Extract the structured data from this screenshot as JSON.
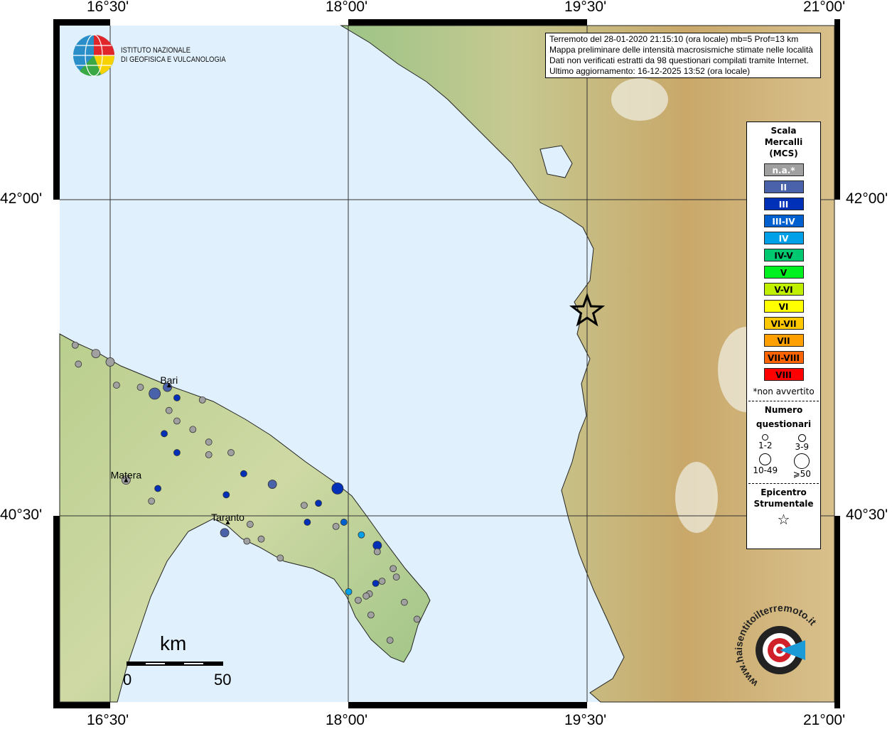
{
  "ticks": {
    "top": [
      "16°30'",
      "18°00'",
      "19°30'",
      "21°00'"
    ],
    "bottom": [
      "16°30'",
      "18°00'",
      "19°30'",
      "21°00'"
    ],
    "left": [
      "42°00'",
      "40°30'"
    ],
    "right": [
      "42°00'",
      "40°30'"
    ]
  },
  "logo_ingv": {
    "line1": "ISTITUTO NAZIONALE",
    "line2": "DI GEOFISICA E VULCANOLOGIA"
  },
  "logo_hsit": "www.haisentitoilterremoto.it",
  "info": {
    "line1": "Terremoto del 28-01-2020 21:15:10 (ora locale) mb=5 Prof=13 km",
    "line2": "Mappa preliminare delle intensità macrosismiche stimate nelle località",
    "line3": "Dati non verificati estratti da 98 questionari compilati tramite Internet.",
    "line4": "Ultimo aggiornamento: 16-12-2025 13:52 (ora locale)"
  },
  "legend": {
    "title1": "Scala",
    "title2": "Mercalli",
    "title3": "(MCS)",
    "classes": [
      {
        "label": "n.a.*",
        "color": "#a0a0a0",
        "text": "#ffffff"
      },
      {
        "label": "II",
        "color": "#4a62aa",
        "text": "#ffffff"
      },
      {
        "label": "III",
        "color": "#0030b8",
        "text": "#ffffff"
      },
      {
        "label": "III-IV",
        "color": "#0060d0",
        "text": "#ffffff"
      },
      {
        "label": "IV",
        "color": "#00a0e8",
        "text": "#ffffff"
      },
      {
        "label": "IV-V",
        "color": "#00c870",
        "text": "#000000"
      },
      {
        "label": "V",
        "color": "#00f020",
        "text": "#000000"
      },
      {
        "label": "V-VI",
        "color": "#c0f000",
        "text": "#000000"
      },
      {
        "label": "VI",
        "color": "#ffff00",
        "text": "#000000"
      },
      {
        "label": "VI-VII",
        "color": "#ffc800",
        "text": "#000000"
      },
      {
        "label": "VII",
        "color": "#ffa000",
        "text": "#000000"
      },
      {
        "label": "VII-VIII",
        "color": "#ff6400",
        "text": "#000000"
      },
      {
        "label": "VIII",
        "color": "#ff0000",
        "text": "#000000"
      }
    ],
    "note": "*non avvertito",
    "count_title1": "Numero",
    "count_title2": "questionari",
    "counts": [
      "1-2",
      "3-9",
      "10-49",
      "⩾50"
    ],
    "epi_title1": "Epicentro",
    "epi_title2": "Strumentale"
  },
  "scalebar": {
    "unit": "km",
    "start": "0",
    "end": "50"
  },
  "cities": [
    {
      "name": "Bari",
      "lon": 16.87,
      "lat": 41.12
    },
    {
      "name": "Matera",
      "lon": 16.6,
      "lat": 40.67
    },
    {
      "name": "Taranto",
      "lon": 17.24,
      "lat": 40.47
    }
  ],
  "epicenter": {
    "lon": 19.5,
    "lat": 41.47
  },
  "points": [
    {
      "lon": 16.28,
      "lat": 41.31,
      "mcs": "n.a.*",
      "n": "1-2"
    },
    {
      "lon": 16.41,
      "lat": 41.27,
      "mcs": "n.a.*",
      "n": "3-9"
    },
    {
      "lon": 16.5,
      "lat": 41.23,
      "mcs": "n.a.*",
      "n": "3-9"
    },
    {
      "lon": 16.3,
      "lat": 41.22,
      "mcs": "n.a.*",
      "n": "1-2"
    },
    {
      "lon": 16.54,
      "lat": 41.12,
      "mcs": "n.a.*",
      "n": "1-2"
    },
    {
      "lon": 16.69,
      "lat": 41.11,
      "mcs": "n.a.*",
      "n": "1-2"
    },
    {
      "lon": 16.78,
      "lat": 41.08,
      "mcs": "II",
      "n": "10-49"
    },
    {
      "lon": 16.86,
      "lat": 41.11,
      "mcs": "II",
      "n": "3-9"
    },
    {
      "lon": 16.92,
      "lat": 41.06,
      "mcs": "III",
      "n": "1-2"
    },
    {
      "lon": 17.08,
      "lat": 41.05,
      "mcs": "n.a.*",
      "n": "1-2"
    },
    {
      "lon": 16.87,
      "lat": 41.0,
      "mcs": "n.a.*",
      "n": "1-2"
    },
    {
      "lon": 16.92,
      "lat": 40.95,
      "mcs": "n.a.*",
      "n": "1-2"
    },
    {
      "lon": 17.02,
      "lat": 40.91,
      "mcs": "n.a.*",
      "n": "1-2"
    },
    {
      "lon": 16.84,
      "lat": 40.89,
      "mcs": "III",
      "n": "1-2"
    },
    {
      "lon": 17.12,
      "lat": 40.85,
      "mcs": "n.a.*",
      "n": "1-2"
    },
    {
      "lon": 16.92,
      "lat": 40.8,
      "mcs": "III",
      "n": "1-2"
    },
    {
      "lon": 17.12,
      "lat": 40.79,
      "mcs": "n.a.*",
      "n": "1-2"
    },
    {
      "lon": 17.26,
      "lat": 40.8,
      "mcs": "n.a.*",
      "n": "1-2"
    },
    {
      "lon": 16.6,
      "lat": 40.67,
      "mcs": "n.a.*",
      "n": "3-9"
    },
    {
      "lon": 17.34,
      "lat": 40.7,
      "mcs": "III",
      "n": "1-2"
    },
    {
      "lon": 17.52,
      "lat": 40.65,
      "mcs": "II",
      "n": "3-9"
    },
    {
      "lon": 16.8,
      "lat": 40.63,
      "mcs": "III",
      "n": "1-2"
    },
    {
      "lon": 17.23,
      "lat": 40.6,
      "mcs": "III",
      "n": "1-2"
    },
    {
      "lon": 16.76,
      "lat": 40.57,
      "mcs": "n.a.*",
      "n": "1-2"
    },
    {
      "lon": 17.93,
      "lat": 40.63,
      "mcs": "III",
      "n": "10-49"
    },
    {
      "lon": 17.72,
      "lat": 40.55,
      "mcs": "n.a.*",
      "n": "1-2"
    },
    {
      "lon": 17.81,
      "lat": 40.56,
      "mcs": "III",
      "n": "1-2"
    },
    {
      "lon": 17.74,
      "lat": 40.47,
      "mcs": "III",
      "n": "1-2"
    },
    {
      "lon": 17.97,
      "lat": 40.47,
      "mcs": "III-IV",
      "n": "1-2"
    },
    {
      "lon": 17.92,
      "lat": 40.45,
      "mcs": "n.a.*",
      "n": "1-2"
    },
    {
      "lon": 17.38,
      "lat": 40.46,
      "mcs": "n.a.*",
      "n": "1-2"
    },
    {
      "lon": 17.22,
      "lat": 40.42,
      "mcs": "II",
      "n": "3-9"
    },
    {
      "lon": 17.36,
      "lat": 40.38,
      "mcs": "n.a.*",
      "n": "1-2"
    },
    {
      "lon": 17.45,
      "lat": 40.39,
      "mcs": "n.a.*",
      "n": "1-2"
    },
    {
      "lon": 17.57,
      "lat": 40.3,
      "mcs": "n.a.*",
      "n": "1-2"
    },
    {
      "lon": 18.08,
      "lat": 40.41,
      "mcs": "IV",
      "n": "1-2"
    },
    {
      "lon": 18.18,
      "lat": 40.36,
      "mcs": "III",
      "n": "3-9"
    },
    {
      "lon": 18.18,
      "lat": 40.33,
      "mcs": "n.a.*",
      "n": "1-2"
    },
    {
      "lon": 18.28,
      "lat": 40.25,
      "mcs": "n.a.*",
      "n": "1-2"
    },
    {
      "lon": 18.3,
      "lat": 40.21,
      "mcs": "n.a.*",
      "n": "1-2"
    },
    {
      "lon": 18.21,
      "lat": 40.19,
      "mcs": "n.a.*",
      "n": "1-2"
    },
    {
      "lon": 18.17,
      "lat": 40.18,
      "mcs": "III",
      "n": "1-2"
    },
    {
      "lon": 18.0,
      "lat": 40.14,
      "mcs": "IV",
      "n": "1-2"
    },
    {
      "lon": 18.13,
      "lat": 40.13,
      "mcs": "n.a.*",
      "n": "1-2"
    },
    {
      "lon": 18.11,
      "lat": 40.12,
      "mcs": "n.a.*",
      "n": "1-2"
    },
    {
      "lon": 18.06,
      "lat": 40.1,
      "mcs": "n.a.*",
      "n": "1-2"
    },
    {
      "lon": 18.35,
      "lat": 40.09,
      "mcs": "n.a.*",
      "n": "1-2"
    },
    {
      "lon": 18.14,
      "lat": 40.03,
      "mcs": "n.a.*",
      "n": "1-2"
    },
    {
      "lon": 18.43,
      "lat": 40.01,
      "mcs": "n.a.*",
      "n": "1-2"
    },
    {
      "lon": 18.26,
      "lat": 39.91,
      "mcs": "n.a.*",
      "n": "1-2"
    }
  ]
}
